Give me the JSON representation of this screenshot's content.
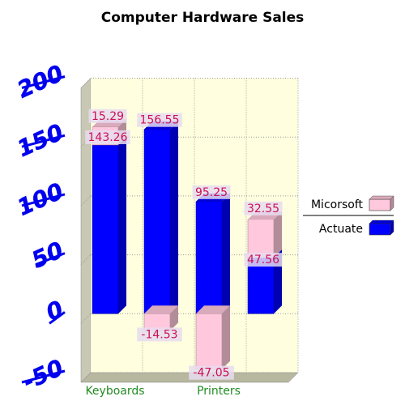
{
  "chart_data": {
    "type": "bar",
    "stacked": true,
    "title": "Computer Hardware Sales",
    "categories": [
      "Keyboards",
      "",
      "Printers",
      ""
    ],
    "ylim": [
      -50,
      200
    ],
    "yticks": [
      "-50",
      "0",
      "50",
      "100",
      "150",
      "200"
    ],
    "grid": true,
    "legend_position": "right",
    "series": [
      {
        "name": "Actuate",
        "color": "#0000ff",
        "values": [
          143.26,
          156.55,
          95.25,
          47.56
        ],
        "labels": [
          "143.26",
          "156.55",
          "95.25",
          "47.56"
        ]
      },
      {
        "name": "Micorsoft",
        "color": "#ffc8dc",
        "values": [
          15.29,
          -14.53,
          -47.05,
          32.55
        ],
        "labels": [
          "15.29",
          "-14.53",
          "-47.05",
          "32.55"
        ]
      }
    ],
    "legend_order": [
      "Micorsoft",
      "Actuate"
    ]
  }
}
